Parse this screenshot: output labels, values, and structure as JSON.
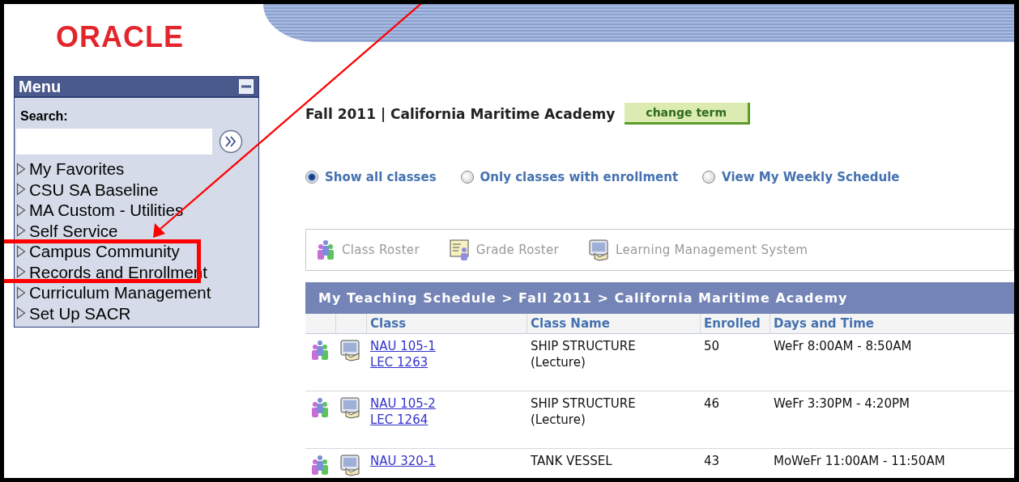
{
  "logo": {
    "text": "ORACLE"
  },
  "menu": {
    "title": "Menu",
    "search_label": "Search:",
    "items": [
      {
        "label": "My Favorites"
      },
      {
        "label": "CSU SA Baseline"
      },
      {
        "label": "MA Custom - Utilities"
      },
      {
        "label": "Self Service"
      },
      {
        "label": "Campus Community"
      },
      {
        "label": "Records and Enrollment"
      },
      {
        "label": "Curriculum Management"
      },
      {
        "label": "Set Up SACR"
      }
    ]
  },
  "term": {
    "title": "Fall 2011 | California Maritime Academy",
    "button": "change term"
  },
  "view_options": [
    {
      "label": "Show all classes",
      "selected": true
    },
    {
      "label": "Only classes with enrollment",
      "selected": false
    },
    {
      "label": "View My Weekly Schedule",
      "selected": false
    }
  ],
  "toolbar": [
    {
      "kind": "roster",
      "label": "Class Roster"
    },
    {
      "kind": "grade",
      "label": "Grade Roster"
    },
    {
      "kind": "lms",
      "label": "Learning Management System"
    }
  ],
  "schedule": {
    "title": "My Teaching Schedule > Fall 2011 > California Maritime Academy",
    "columns": [
      "Class",
      "Class Name",
      "Enrolled",
      "Days and Time"
    ],
    "rows": [
      {
        "class": "NAU 105-1",
        "section": "LEC 1263",
        "name": "SHIP STRUCTURE",
        "component": "(Lecture)",
        "enrolled": "50",
        "time": "WeFr 8:00AM - 8:50AM"
      },
      {
        "class": "NAU 105-2",
        "section": "LEC 1264",
        "name": "SHIP STRUCTURE",
        "component": "(Lecture)",
        "enrolled": "46",
        "time": "WeFr 3:30PM - 4:20PM"
      },
      {
        "class": "NAU 320-1",
        "name": "TANK VESSEL",
        "enrolled": "43",
        "time": "MoWeFr 11:00AM - 11:50AM"
      }
    ]
  }
}
